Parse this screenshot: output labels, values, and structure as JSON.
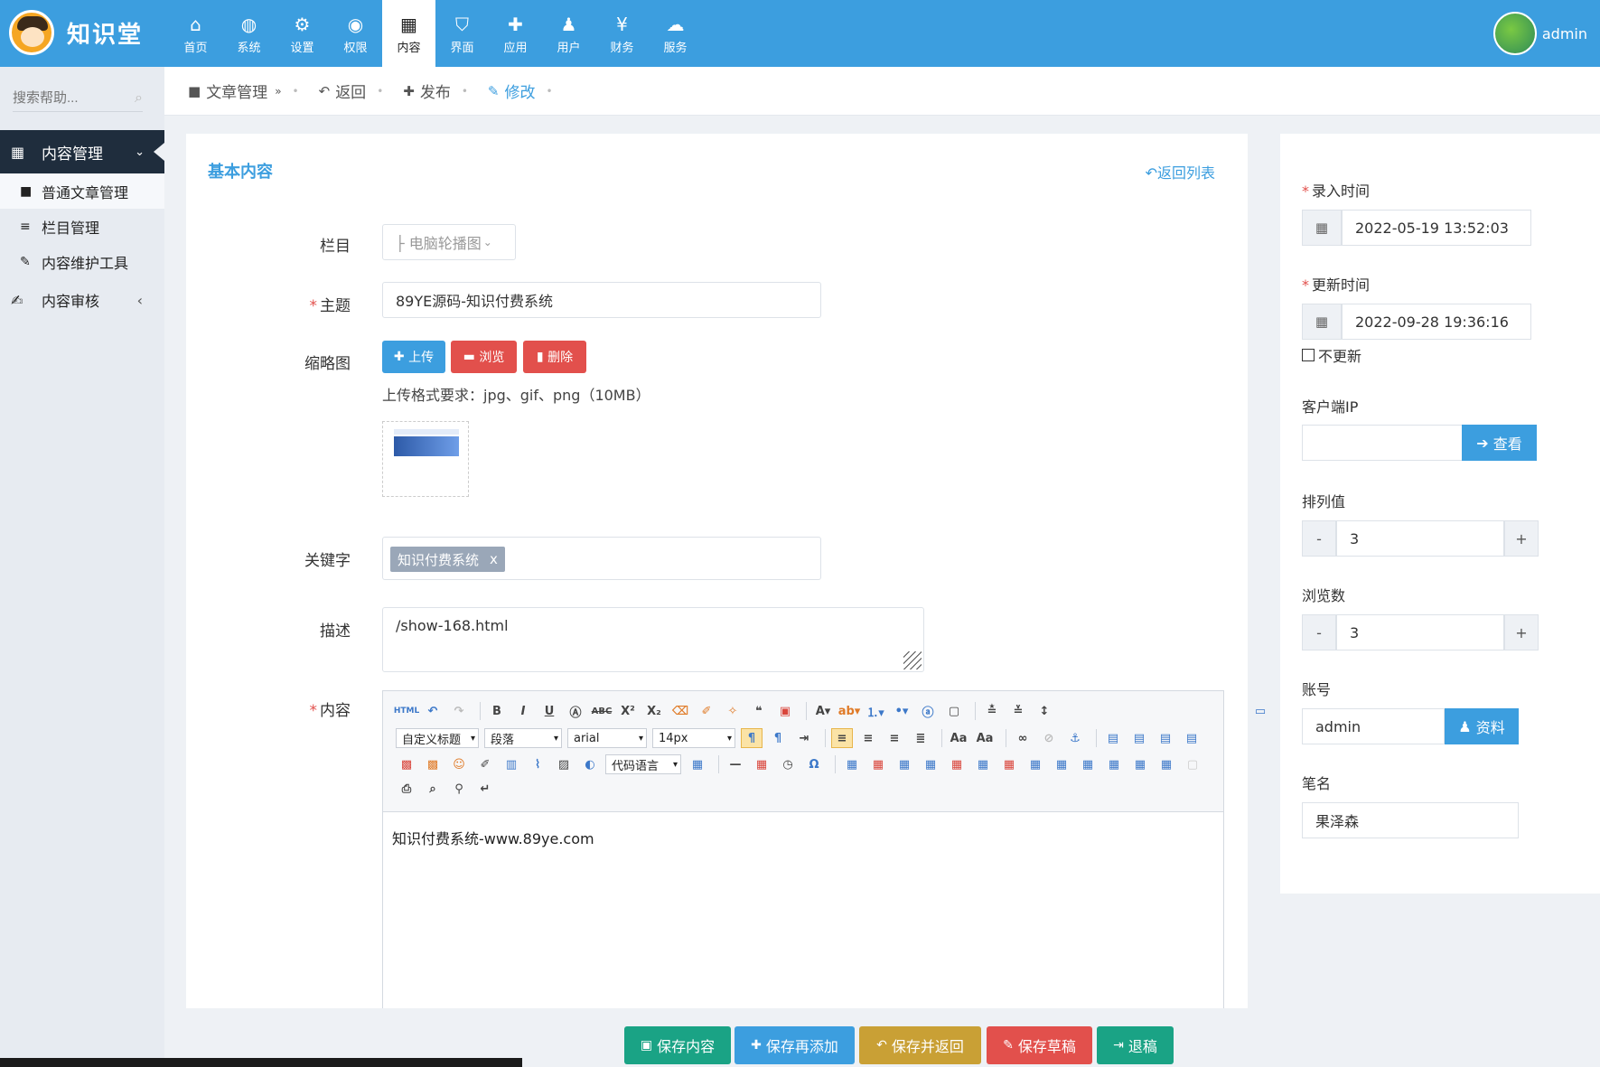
{
  "app": {
    "name": "知识堂",
    "user": "admin"
  },
  "nav": [
    {
      "label": "首页",
      "icon": "home-icon",
      "glyph": "⌂"
    },
    {
      "label": "系统",
      "icon": "globe-icon",
      "glyph": "◍"
    },
    {
      "label": "设置",
      "icon": "gears-icon",
      "glyph": "⚙"
    },
    {
      "label": "权限",
      "icon": "user-circle-icon",
      "glyph": "◉"
    },
    {
      "label": "内容",
      "icon": "grid-icon",
      "glyph": "▦"
    },
    {
      "label": "界面",
      "icon": "html5-icon",
      "glyph": "⛉"
    },
    {
      "label": "应用",
      "icon": "puzzle-icon",
      "glyph": "✚"
    },
    {
      "label": "用户",
      "icon": "user-icon",
      "glyph": "♟"
    },
    {
      "label": "财务",
      "icon": "yen-icon",
      "glyph": "¥"
    },
    {
      "label": "服务",
      "icon": "cloud-icon",
      "glyph": "☁"
    }
  ],
  "sidebar": {
    "search_placeholder": "搜索帮助...",
    "group": "内容管理",
    "items": [
      "普通文章管理",
      "栏目管理",
      "内容维护工具"
    ],
    "audit": "内容审核"
  },
  "breadcrumb": {
    "manage": "文章管理",
    "back": "返回",
    "publish": "发布",
    "edit": "修改"
  },
  "form": {
    "section_title": "基本内容",
    "back_list": "返回列表",
    "column_label": "栏目",
    "column_value": "├ 电脑轮播图",
    "subject_label": "主题",
    "subject_value": "89YE源码-知识付费系统",
    "thumb_label": "缩略图",
    "upload": "上传",
    "browse": "浏览",
    "delete": "删除",
    "upload_hint": "上传格式要求：jpg、gif、png（10MB）",
    "keyword_label": "关键字",
    "keyword_tag": "知识付费系统",
    "keyword_remove": "x",
    "desc_label": "描述",
    "desc_value": "/show-168.html",
    "content_label": "内容",
    "content_value": "知识付费系统-www.89ye.com"
  },
  "editor": {
    "selects": {
      "heading": "自定义标题",
      "paragraph": "段落",
      "font": "arial",
      "size": "14px",
      "code": "代码语言"
    }
  },
  "right": {
    "entry_time_label": "录入时间",
    "entry_time": "2022-05-19 13:52:03",
    "update_time_label": "更新时间",
    "update_time": "2022-09-28 19:36:16",
    "no_update": "不更新",
    "client_ip_label": "客户端IP",
    "view": "查看",
    "sort_label": "排列值",
    "sort_value": "3",
    "views_label": "浏览数",
    "views_value": "3",
    "minus": "-",
    "plus": "+",
    "account_label": "账号",
    "account_value": "admin",
    "profile": "资料",
    "penname_label": "笔名",
    "penname_value": "果泽森"
  },
  "actions": {
    "save": "保存内容",
    "save_add": "保存再添加",
    "save_back": "保存并返回",
    "save_draft": "保存草稿",
    "reject": "退稿"
  },
  "colors": {
    "primary": "#3c9edf",
    "danger": "#e2504c",
    "teal": "#1aa385",
    "gold": "#c9a035",
    "sidebar_dark": "#1f2d3d"
  }
}
